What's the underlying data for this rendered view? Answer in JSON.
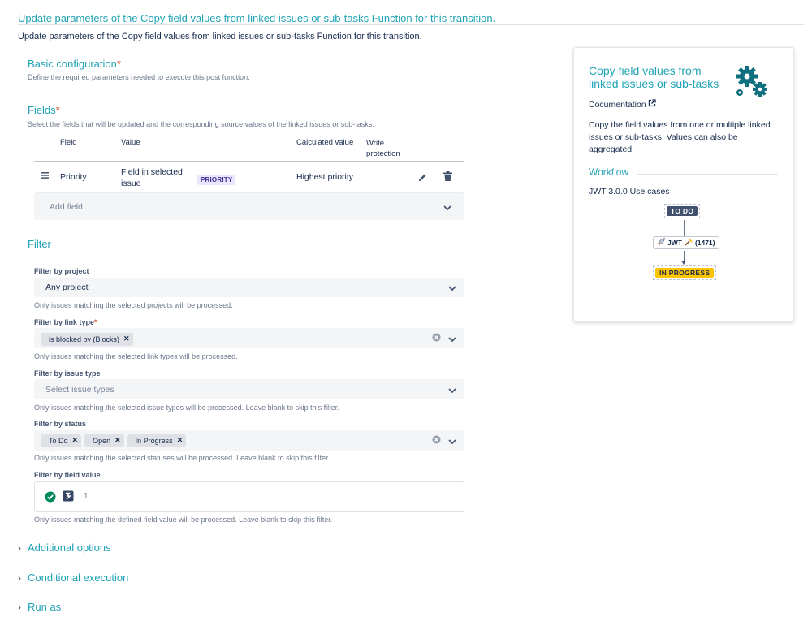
{
  "page": {
    "title": "Update parameters of the Copy field values from linked issues or sub-tasks Function for this transition.",
    "subtitle": "Update parameters of the Copy field values from linked issues or sub-tasks Function for this transition."
  },
  "basic": {
    "heading": "Basic configuration",
    "required": "*",
    "description": "Define the required parameters needed to execute this post function."
  },
  "fields": {
    "heading": "Fields",
    "required": "*",
    "description": "Select the fields that will be updated and the corresponding source values of the linked issues or sub-tasks.",
    "columns": {
      "field": "Field",
      "value": "Value",
      "calculated": "Calculated value",
      "write": "Write protection"
    },
    "rows": [
      {
        "field": "Priority",
        "value": "Field in selected issue",
        "lozenge": "PRIORITY",
        "calculated": "Highest priority"
      }
    ],
    "add_field_placeholder": "Add field"
  },
  "filter": {
    "heading": "Filter",
    "project": {
      "label": "Filter by project",
      "value": "Any project",
      "help": "Only issues matching the selected projects will be processed."
    },
    "link_type": {
      "label": "Filter by link type",
      "required": "*",
      "tags": [
        "is blocked by (Blocks)"
      ],
      "help": "Only issues matching the selected link types will be processed."
    },
    "issue_type": {
      "label": "Filter by issue type",
      "placeholder": "Select issue types",
      "help": "Only issues matching the selected issue types will be processed. Leave blank to skip this filter."
    },
    "status": {
      "label": "Filter by status",
      "tags": [
        "To Do",
        "Open",
        "In Progress"
      ],
      "help": "Only issues matching the selected statuses will be processed. Leave blank to skip this filter."
    },
    "field_value": {
      "label": "Filter by field value",
      "line_number": "1",
      "help": "Only issues matching the defined field value will be processed. Leave blank to skip this filter."
    }
  },
  "collapsibles": {
    "additional": "Additional options",
    "conditional": "Conditional execution",
    "run_as": "Run as"
  },
  "sidebar": {
    "title": "Copy field values from linked issues or sub-tasks",
    "documentation": "Documentation",
    "description": "Copy the field values from one or multiple linked issues or sub-tasks. Values can also be aggregated.",
    "workflow_heading": "Workflow",
    "workflow_sub": "JWT 3.0.0 Use cases",
    "from_status": "TO DO",
    "transition_label": "JWT",
    "transition_id": "(1471)",
    "to_status": "IN PROGRESS"
  },
  "colors": {
    "accent": "#1fa3b5",
    "required": "#de350b",
    "todo": "#42526e",
    "in_progress": "#ffc400",
    "lozenge_bg": "#eae6ff",
    "lozenge_fg": "#403294",
    "valid": "#00875a"
  },
  "icons": {
    "gears": "gears-icon",
    "external": "external-link-icon",
    "drag": "drag-handle-icon",
    "edit": "pencil-icon",
    "delete": "trash-icon",
    "chevron": "chevron-down-icon",
    "clear": "clear-icon",
    "check": "check-circle-icon",
    "parser": "parser-icon",
    "caret": "chevron-right-icon",
    "rocket": "rocket-icon",
    "hammer": "hammer-icon"
  }
}
